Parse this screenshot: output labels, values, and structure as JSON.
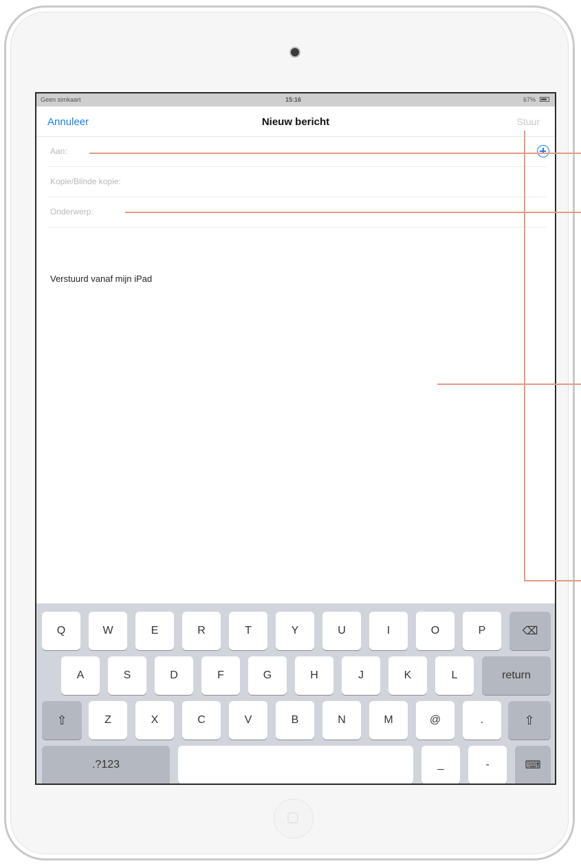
{
  "status_bar": {
    "carrier": "Geen simkaart",
    "time": "15:16",
    "battery": "67%"
  },
  "nav": {
    "cancel": "Annuleer",
    "title": "Nieuw bericht",
    "send": "Stuur"
  },
  "fields": {
    "to_label": "Aan:",
    "cc_bcc_label": "Kopie/Blinde kopie:",
    "subject_label": "Onderwerp:"
  },
  "body": {
    "signature": "Verstuurd vanaf mijn iPad"
  },
  "keyboard": {
    "row1": [
      "Q",
      "W",
      "E",
      "R",
      "T",
      "Y",
      "U",
      "I",
      "O",
      "P"
    ],
    "row2": [
      "A",
      "S",
      "D",
      "F",
      "G",
      "H",
      "J",
      "K",
      "L"
    ],
    "row3": [
      "Z",
      "X",
      "C",
      "V",
      "B",
      "N",
      "M",
      "@",
      "."
    ],
    "row4": {
      "numbers": ".?123",
      "underscore": "_",
      "dash": "-"
    },
    "return_label": "return",
    "delete_symbol": "⌫",
    "shift_symbol": "⇧",
    "hide_symbol": "⌨"
  },
  "colors": {
    "accent": "#1a7fe0",
    "callout": "#e39a83",
    "keyboard_bg": "#d1d5db"
  }
}
